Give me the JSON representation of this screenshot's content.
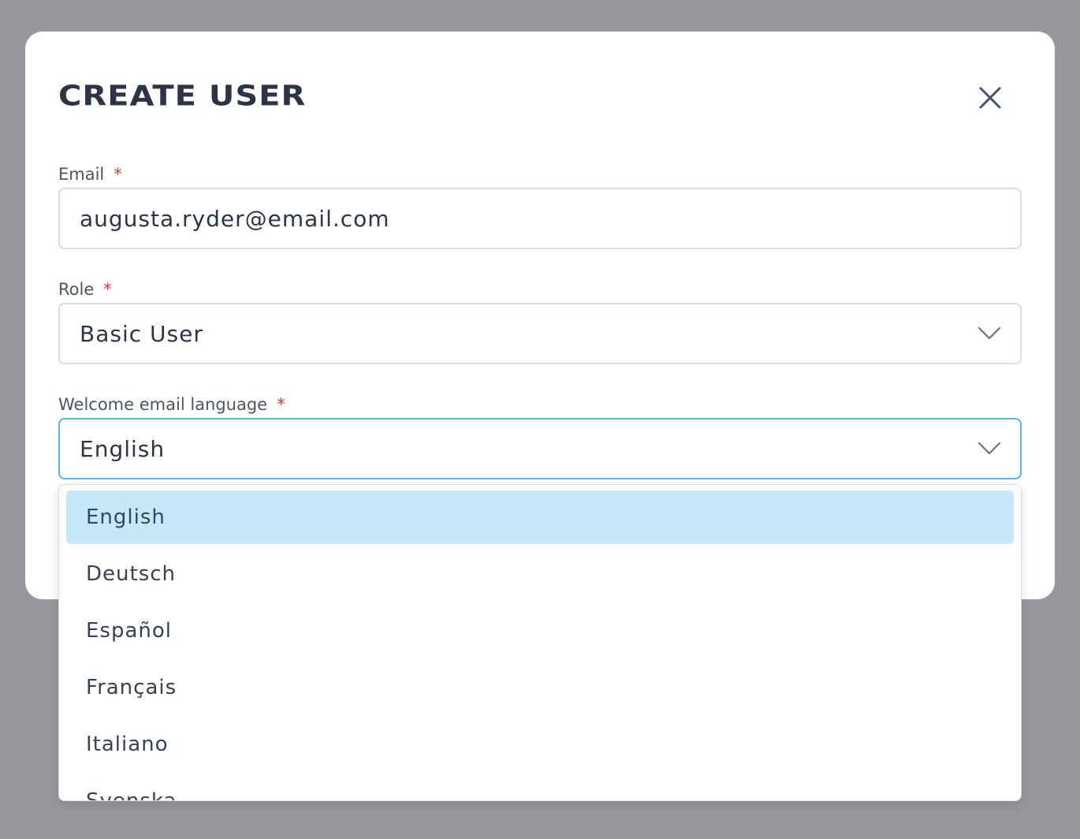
{
  "modal": {
    "title": "CREATE USER"
  },
  "email": {
    "label": "Email",
    "required_mark": "*",
    "value": "augusta.ryder@email.com"
  },
  "role": {
    "label": "Role",
    "required_mark": "*",
    "value": "Basic User"
  },
  "language": {
    "label": "Welcome email language",
    "required_mark": "*",
    "value": "English",
    "options": [
      {
        "label": "English",
        "selected": true
      },
      {
        "label": "Deutsch",
        "selected": false
      },
      {
        "label": "Español",
        "selected": false
      },
      {
        "label": "Français",
        "selected": false
      },
      {
        "label": "Italiano",
        "selected": false
      },
      {
        "label": "Svenska",
        "selected": false
      }
    ]
  },
  "colors": {
    "backdrop": "#97989b",
    "focus_border": "#5ab6e3",
    "selected_option_bg": "#c5e8f8",
    "required": "#e53935"
  },
  "icons": {
    "close": "close-icon",
    "chevron": "chevron-down-icon"
  }
}
